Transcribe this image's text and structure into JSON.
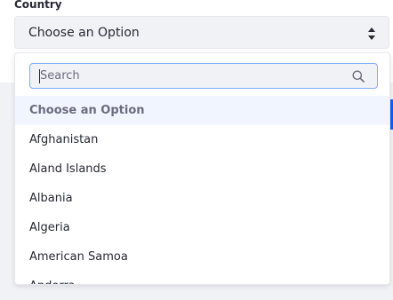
{
  "field": {
    "label": "Country",
    "selected_value": "Choose an Option"
  },
  "dropdown": {
    "search_placeholder": "Search",
    "options": [
      "Choose an Option",
      "Afghanistan",
      "Aland Islands",
      "Albania",
      "Algeria",
      "American Samoa",
      "Andorra"
    ]
  },
  "colors": {
    "accent": "#0b5fff",
    "focus_border": "#80acff",
    "text": "#272833",
    "muted": "#6b6c7e",
    "highlight": "#f0f5ff"
  },
  "icons": {
    "select_arrows": "chevron-up-down-icon",
    "search": "search-icon"
  }
}
